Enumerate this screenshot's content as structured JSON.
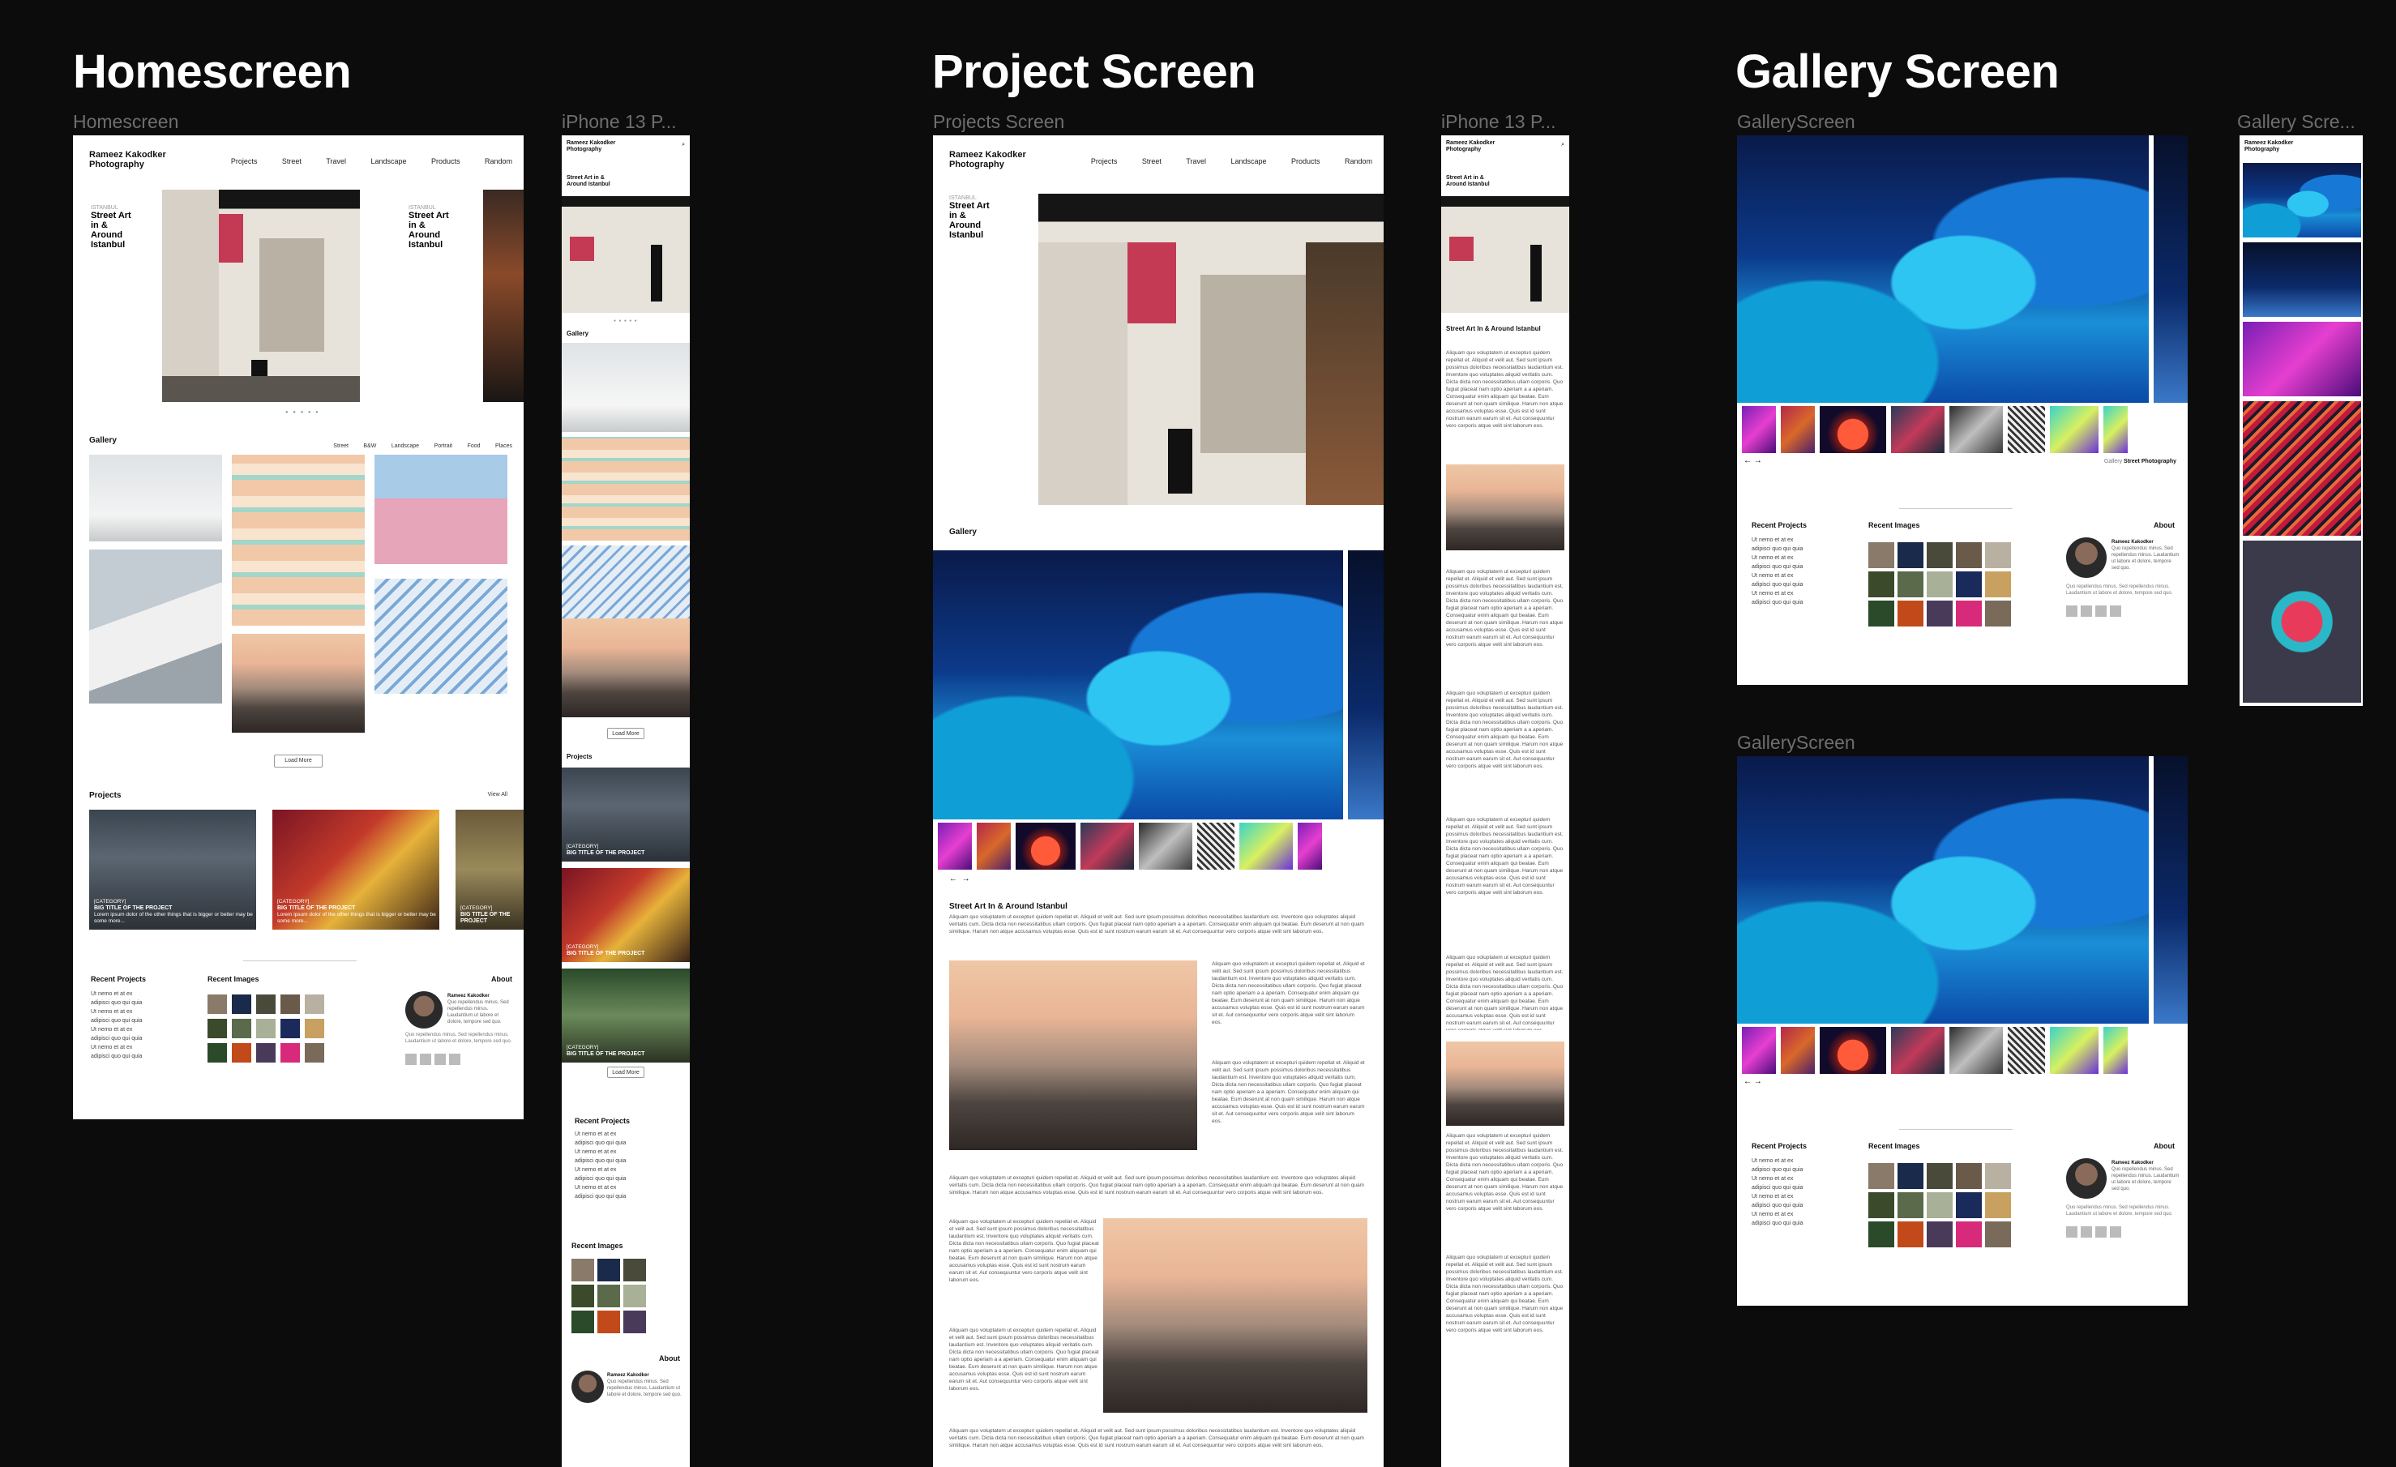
{
  "sections": {
    "home_title": "Homescreen",
    "project_title": "Project Screen",
    "gallery_title": "Gallery Screen"
  },
  "frame_labels": {
    "home_desktop": "Homescreen",
    "home_mobile": "iPhone 13 P...",
    "project_desktop": "Projects Screen",
    "project_mobile": "iPhone 13 P...",
    "gallery_desktop": "GalleryScreen",
    "gallery_mobile": "Gallery Scre...",
    "gallery_desktop_2": "GalleryScreen"
  },
  "site": {
    "brand_line1": "Rameez Kakodker",
    "brand_line2": "Photography",
    "nav": [
      "Projects",
      "Street",
      "Travel",
      "Landscape",
      "Products",
      "Random"
    ]
  },
  "hero": {
    "kicker": "ISTANBUL",
    "title_line1": "Street Art",
    "title_line2": "in &",
    "title_line3": "Around",
    "title_line4": "Istanbul"
  },
  "gallery": {
    "heading": "Gallery",
    "categories": [
      "Street",
      "B&W",
      "Landscape",
      "Portrait",
      "Food",
      "Places"
    ],
    "load_more": "Load More"
  },
  "projects": {
    "heading": "Projects",
    "view_all": "View All",
    "card_category": "[CATEGORY]",
    "card_title": "BIG TITLE OF THE PROJECT",
    "card_sub": "Lorem ipsum dolor of the other things that is bigger or better may be some more..."
  },
  "footer": {
    "recent_projects": "Recent Projects",
    "recent_images": "Recent Images",
    "about": "About",
    "links": [
      "Ut nemo et at ex",
      "adipisci quo qui quia",
      "Ut nemo et at ex",
      "adipisci quo qui quia",
      "Ut nemo et at ex",
      "adipisci quo qui quia",
      "Ut nemo et at ex",
      "adipisci quo qui quia"
    ],
    "about_name": "Rameez Kakodker",
    "about_text": "Quo repellendus minus. Sed repellendus minus. Laudantium ut labore et dolore, tempore sed quo."
  },
  "project_page": {
    "title": "Street Art In & Around Istanbul",
    "lorem": "Aliquam quo voluptatem ut excepturi quidem repellat et. Aliquid et velit aut. Sed sunt ipsum possimus doloribus necessitatibus laudantium est. Inventore quo voluptates aliquid veritatis cum. Dicta dicta non necessitatibus ullam corporis. Quo fugiat placeat nam optio aperiam a a aperiam. Consequatur enim aliquam qui beatae. Eum deserunt at non quam similique. Harum non atque accusamus voluptas esse. Quis est id sunt nostrum earum earum sit et. Aut consequuntur vero corporis atque velit sint laborum eos."
  },
  "gallery_page": {
    "breadcrumb_root": "Gallery",
    "breadcrumb_current": "Street Photography",
    "prev": "←",
    "next": "→"
  }
}
